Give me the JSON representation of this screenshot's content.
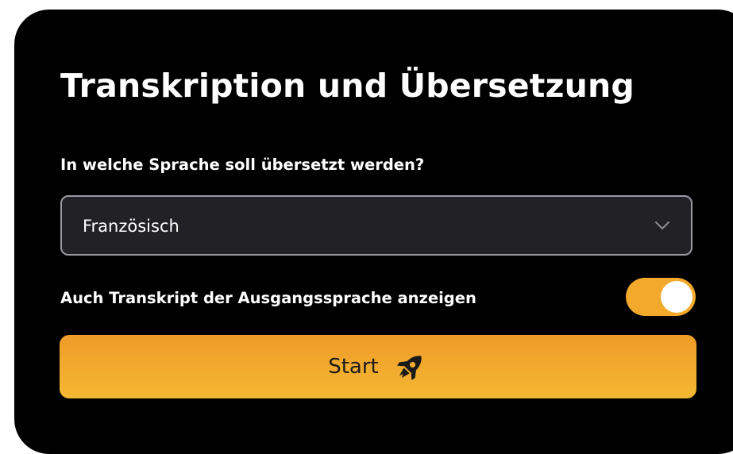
{
  "panel": {
    "title": "Transkription und Übersetzung"
  },
  "language_select": {
    "label": "In welche Sprache soll übersetzt werden?",
    "selected_value": "Französisch",
    "icon": "chevron-down-icon"
  },
  "source_transcript_toggle": {
    "label": "Auch Transkript der Ausgangssprache anzeigen",
    "checked": true,
    "on_color": "#f3a92c"
  },
  "start_button": {
    "label": "Start",
    "icon": "rocket-icon",
    "colors": {
      "gradient_top": "#ef9b29",
      "gradient_bottom": "#f4b832"
    }
  }
}
